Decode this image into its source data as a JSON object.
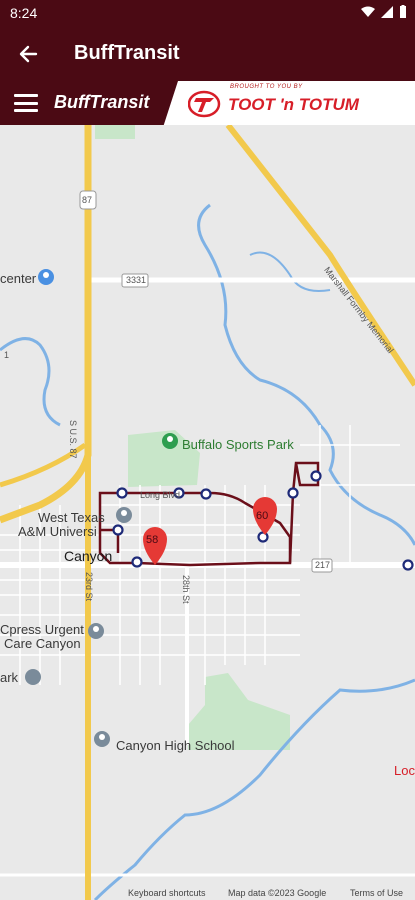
{
  "status": {
    "time": "8:24"
  },
  "appbar": {
    "title": "BuffTransit"
  },
  "banner": {
    "brand": "BuffTransit",
    "sponsor_tagline": "BROUGHT TO YOU BY",
    "sponsor_name": "TOOT 'n TOTUM"
  },
  "map": {
    "labels": {
      "center": "center",
      "buffalo_sports_park": "Buffalo Sports Park",
      "west_texas_1": "West Texas",
      "west_texas_2": "A&M Universi",
      "canyon": "Canyon",
      "cpress_1": "Cpress Urgent",
      "cpress_2": "Care Canyon",
      "ark": "ark",
      "canyon_high": "Canyon High School",
      "loc": "Loc",
      "hwy_3331": "3331",
      "hwy_217": "217",
      "hwy_87": "87",
      "us_87": "S U.S. 87",
      "rd_23rd": "23rd St",
      "rd_28th": "28th St",
      "marshall": "Marshall Formby Memorial",
      "long": "Long Blvd",
      "one": "1"
    },
    "markers": [
      {
        "route": "58"
      },
      {
        "route": "60"
      }
    ],
    "footer": {
      "shortcuts": "Keyboard shortcuts",
      "data": "Map data ©2023 Google",
      "terms": "Terms of Use"
    },
    "colors": {
      "route": "#6b0f1a",
      "marker": "#e53935",
      "stop_ring": "#1e2a78",
      "highway": "#f2c94c",
      "water": "#7fb2e5",
      "park": "#c8e6c9"
    }
  }
}
